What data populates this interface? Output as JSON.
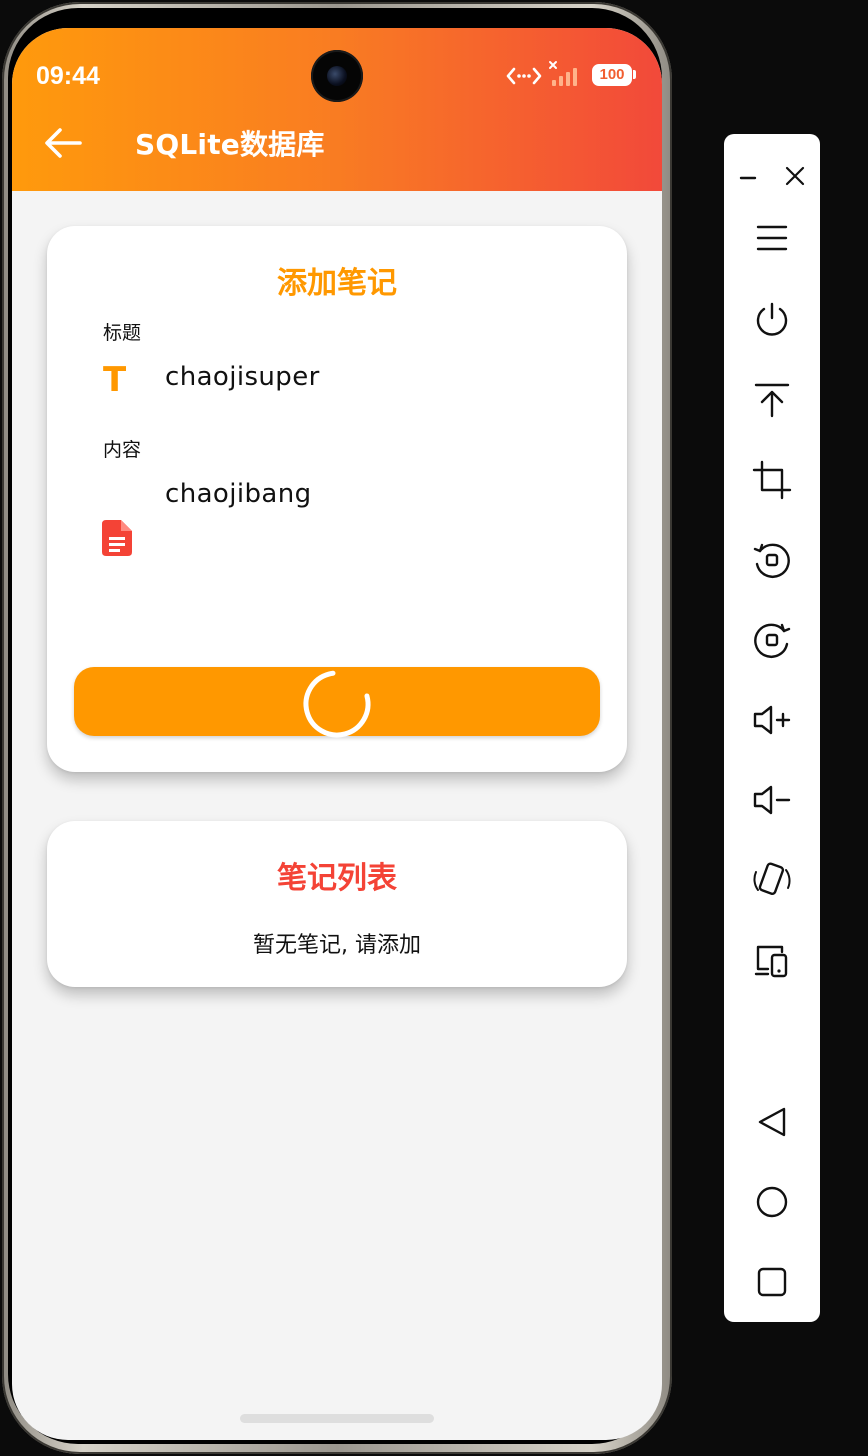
{
  "status_bar": {
    "time": "09:44",
    "battery": "100",
    "icons": [
      "data-transfer-icon",
      "signal-icon",
      "battery-icon"
    ]
  },
  "header": {
    "back_icon": "arrow-left-icon",
    "title": "SQLite数据库"
  },
  "add_note": {
    "title": "添加笔记",
    "title_label": "标题",
    "title_value": "chaojisuper",
    "title_icon": "T",
    "content_label": "内容",
    "content_value": "chaojibang",
    "content_icon": "document-icon",
    "submit_state": "loading"
  },
  "note_list": {
    "title": "笔记列表",
    "empty_text": "暂无笔记, 请添加"
  },
  "colors": {
    "accent_orange": "#ff9800",
    "accent_red": "#f44336",
    "header_start": "#ff9a0c",
    "header_end": "#f2493a",
    "background": "#f4f4f4"
  },
  "side_toolbar": {
    "buttons": [
      "minimize",
      "close",
      "menu",
      "power",
      "move-to-top",
      "crop",
      "rotate-left",
      "rotate-right",
      "volume-up",
      "volume-down",
      "rotate-device",
      "switch-display",
      "back",
      "home",
      "recents"
    ]
  }
}
